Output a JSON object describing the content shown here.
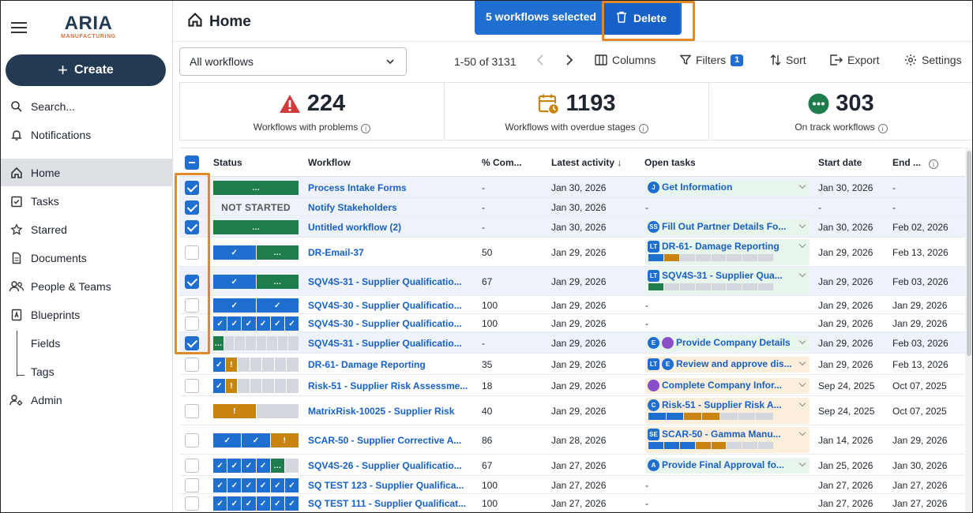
{
  "logo": {
    "name": "ARIA",
    "tagline": "MANUFACTURING"
  },
  "sidebar": {
    "create_label": "Create",
    "items": [
      {
        "label": "Search...",
        "icon": "search-icon",
        "active": false
      },
      {
        "label": "Notifications",
        "icon": "bell-icon",
        "active": false
      },
      {
        "label": "Home",
        "icon": "home-icon",
        "active": true
      },
      {
        "label": "Tasks",
        "icon": "tasks-icon",
        "active": false
      },
      {
        "label": "Starred",
        "icon": "star-icon",
        "active": false
      },
      {
        "label": "Documents",
        "icon": "document-icon",
        "active": false
      },
      {
        "label": "People & Teams",
        "icon": "people-icon",
        "active": false
      },
      {
        "label": "Blueprints",
        "icon": "blueprint-icon",
        "active": false
      },
      {
        "label": "Fields",
        "icon": "",
        "active": false
      },
      {
        "label": "Tags",
        "icon": "",
        "active": false
      },
      {
        "label": "Admin",
        "icon": "admin-icon",
        "active": false
      }
    ]
  },
  "header": {
    "title": "Home"
  },
  "selection": {
    "count_label": "5 workflows selected",
    "delete_label": "Delete"
  },
  "toolbar": {
    "filter_select": "All workflows",
    "range": "1-50 of 3131",
    "columns": "Columns",
    "filters": "Filters",
    "filters_count": "1",
    "sort": "Sort",
    "export": "Export",
    "settings": "Settings"
  },
  "stats": [
    {
      "value": "224",
      "label": "Workflows with problems",
      "icon": "warning-icon",
      "color": "#d13b3b"
    },
    {
      "value": "1193",
      "label": "Workflows with overdue stages",
      "icon": "calendar-clock-icon",
      "color": "#c98410"
    },
    {
      "value": "303",
      "label": "On track workflows",
      "icon": "more-circle-icon",
      "color": "#1e7c4d"
    }
  ],
  "columns": {
    "status": "Status",
    "workflow": "Workflow",
    "complete": "% Com...",
    "latest": "Latest activity",
    "open_tasks": "Open tasks",
    "start": "Start date",
    "end": "End ..."
  },
  "rows": [
    {
      "checked": true,
      "status": [
        [
          "g",
          "…"
        ]
      ],
      "name": "Process Intake Forms",
      "pct": "-",
      "latest": "Jan 30, 2026",
      "task": {
        "av": [
          [
            "J",
            "c"
          ]
        ],
        "text": "Get Information",
        "bg": "green",
        "bar": null
      },
      "start": "Jan 30, 2026",
      "end": "-"
    },
    {
      "checked": true,
      "status": "NOT STARTED",
      "name": "Notify Stakeholders",
      "pct": "-",
      "latest": "Jan 30, 2026",
      "task": null,
      "start": "-",
      "end": "-"
    },
    {
      "checked": true,
      "status": [
        [
          "g",
          "…"
        ]
      ],
      "name": "Untitled workflow (2)",
      "pct": "-",
      "latest": "Jan 30, 2026",
      "task": {
        "av": [
          [
            "SS",
            "c"
          ]
        ],
        "text": "Fill Out Partner Details Fo...",
        "bg": "green",
        "bar": null
      },
      "start": "Jan 30, 2026",
      "end": "Feb 02, 2026"
    },
    {
      "checked": false,
      "status": [
        [
          "d",
          "✓"
        ],
        [
          "g",
          "…"
        ]
      ],
      "name": "DR-Email-37",
      "pct": "50",
      "latest": "Jan 29, 2026",
      "task": {
        "av": [
          [
            "LT",
            "s"
          ]
        ],
        "text": "DR-61- Damage Reporting",
        "bg": "green",
        "bar": [
          "d",
          "o",
          "e",
          "e",
          "e",
          "e",
          "e",
          "e"
        ]
      },
      "start": "Jan 29, 2026",
      "end": "Feb 13, 2026"
    },
    {
      "checked": true,
      "status": [
        [
          "d",
          "✓"
        ],
        [
          "g",
          "…"
        ]
      ],
      "name": "SQV4S-31 - Supplier Qualificatio...",
      "pct": "67",
      "latest": "Jan 29, 2026",
      "task": {
        "av": [
          [
            "LT",
            "s"
          ]
        ],
        "text": "SQV4S-31 - Supplier Qua...",
        "bg": "green",
        "bar": [
          "g",
          "e",
          "e",
          "e",
          "e",
          "e",
          "e",
          "e"
        ]
      },
      "start": "Jan 29, 2026",
      "end": "Feb 03, 2026"
    },
    {
      "checked": false,
      "status": [
        [
          "d",
          "✓"
        ],
        [
          "d",
          "✓"
        ]
      ],
      "name": "SQV4S-30 - Supplier Qualificatio...",
      "pct": "100",
      "latest": "Jan 29, 2026",
      "task": null,
      "start": "Jan 29, 2026",
      "end": "Jan 29, 2026"
    },
    {
      "checked": false,
      "status": [
        [
          "d",
          "✓"
        ],
        [
          "d",
          "✓"
        ],
        [
          "d",
          "✓"
        ],
        [
          "d",
          "✓"
        ],
        [
          "d",
          "✓"
        ],
        [
          "d",
          "✓"
        ]
      ],
      "name": "SQV4S-30 - Supplier Qualificatio...",
      "pct": "100",
      "latest": "Jan 29, 2026",
      "task": null,
      "start": "Jan 29, 2026",
      "end": "Jan 29, 2026"
    },
    {
      "checked": true,
      "status": [
        [
          "g",
          "…"
        ],
        [
          "e",
          ""
        ],
        [
          "e",
          ""
        ],
        [
          "e",
          ""
        ],
        [
          "e",
          ""
        ],
        [
          "e",
          ""
        ],
        [
          "e",
          ""
        ],
        [
          "e",
          ""
        ]
      ],
      "name": "SQV4S-31 - Supplier Qualificatio...",
      "pct": "-",
      "latest": "Jan 29, 2026",
      "task": {
        "av": [
          [
            "E",
            "c"
          ],
          [
            "",
            "p"
          ]
        ],
        "text": "Provide Company Details",
        "bg": "green",
        "bar": null
      },
      "start": "Jan 29, 2026",
      "end": "Feb 03, 2026"
    },
    {
      "checked": false,
      "status": [
        [
          "d",
          "✓"
        ],
        [
          "o",
          "!"
        ],
        [
          "e",
          ""
        ],
        [
          "e",
          ""
        ],
        [
          "e",
          ""
        ],
        [
          "e",
          ""
        ],
        [
          "e",
          ""
        ]
      ],
      "name": "DR-61- Damage Reporting",
      "pct": "35",
      "latest": "Jan 29, 2026",
      "task": {
        "av": [
          [
            "LT",
            "s"
          ],
          [
            "E",
            "c"
          ]
        ],
        "text": "Review and approve dis...",
        "bg": "amber",
        "bar": null
      },
      "start": "Jan 29, 2026",
      "end": "Feb 13, 2026"
    },
    {
      "checked": false,
      "status": [
        [
          "d",
          "✓"
        ],
        [
          "o",
          "!"
        ],
        [
          "e",
          ""
        ],
        [
          "e",
          ""
        ],
        [
          "e",
          ""
        ],
        [
          "e",
          ""
        ],
        [
          "e",
          ""
        ]
      ],
      "name": "Risk-51 - Supplier Risk Assessme...",
      "pct": "18",
      "latest": "Jan 29, 2026",
      "task": {
        "av": [
          [
            "",
            "p"
          ]
        ],
        "text": "Complete Company Infor...",
        "bg": "amber",
        "bar": null
      },
      "start": "Sep 24, 2025",
      "end": "Oct 07, 2025"
    },
    {
      "checked": false,
      "status": [
        [
          "o",
          "!"
        ],
        [
          "e",
          ""
        ]
      ],
      "name": "MatrixRisk-10025 - Supplier Risk",
      "pct": "40",
      "latest": "Jan 29, 2026",
      "task": {
        "av": [
          [
            "C",
            "c"
          ]
        ],
        "text": "Risk-51 - Supplier Risk A...",
        "bg": "amber",
        "bar": [
          "d",
          "d",
          "o",
          "o",
          "e",
          "e",
          "e"
        ]
      },
      "start": "Sep 24, 2025",
      "end": "Oct 07, 2025"
    },
    {
      "checked": false,
      "status": [
        [
          "d",
          "✓"
        ],
        [
          "d",
          "✓"
        ],
        [
          "o",
          "!"
        ]
      ],
      "name": "SCAR-50 - Supplier Corrective A...",
      "pct": "86",
      "latest": "Jan 28, 2026",
      "task": {
        "av": [
          [
            "SE",
            "s"
          ]
        ],
        "text": "SCAR-50 - Gamma Manu...",
        "bg": "amber",
        "bar": [
          "d",
          "d",
          "d",
          "o",
          "o",
          "e",
          "e",
          "e"
        ]
      },
      "start": "Jan 14, 2026",
      "end": "Jan 29, 2026"
    },
    {
      "checked": false,
      "status": [
        [
          "d",
          "✓"
        ],
        [
          "d",
          "✓"
        ],
        [
          "d",
          "✓"
        ],
        [
          "d",
          "✓"
        ],
        [
          "g",
          "…"
        ],
        [
          "e",
          ""
        ]
      ],
      "name": "SQV4S-26 - Supplier Qualificatio...",
      "pct": "67",
      "latest": "Jan 27, 2026",
      "task": {
        "av": [
          [
            "A",
            "c"
          ]
        ],
        "text": "Provide Final Approval fo...",
        "bg": "green",
        "bar": null
      },
      "start": "Jan 25, 2026",
      "end": "Jan 30, 2026"
    },
    {
      "checked": false,
      "status": [
        [
          "d",
          "✓"
        ],
        [
          "d",
          "✓"
        ],
        [
          "d",
          "✓"
        ],
        [
          "d",
          "✓"
        ],
        [
          "d",
          "✓"
        ],
        [
          "d",
          "✓"
        ]
      ],
      "name": "SQ TEST 123 - Supplier Qualifica...",
      "pct": "100",
      "latest": "Jan 27, 2026",
      "task": null,
      "start": "Jan 27, 2026",
      "end": "Jan 27, 2026"
    },
    {
      "checked": false,
      "status": [
        [
          "d",
          "✓"
        ],
        [
          "d",
          "✓"
        ],
        [
          "d",
          "✓"
        ],
        [
          "d",
          "✓"
        ],
        [
          "d",
          "✓"
        ],
        [
          "d",
          "✓"
        ]
      ],
      "name": "SQ TEST 111 - Supplier Qualificat...",
      "pct": "100",
      "latest": "Jan 27, 2026",
      "task": null,
      "start": "Jan 27, 2026",
      "end": "Jan 27, 2026"
    }
  ],
  "no_task": "-"
}
